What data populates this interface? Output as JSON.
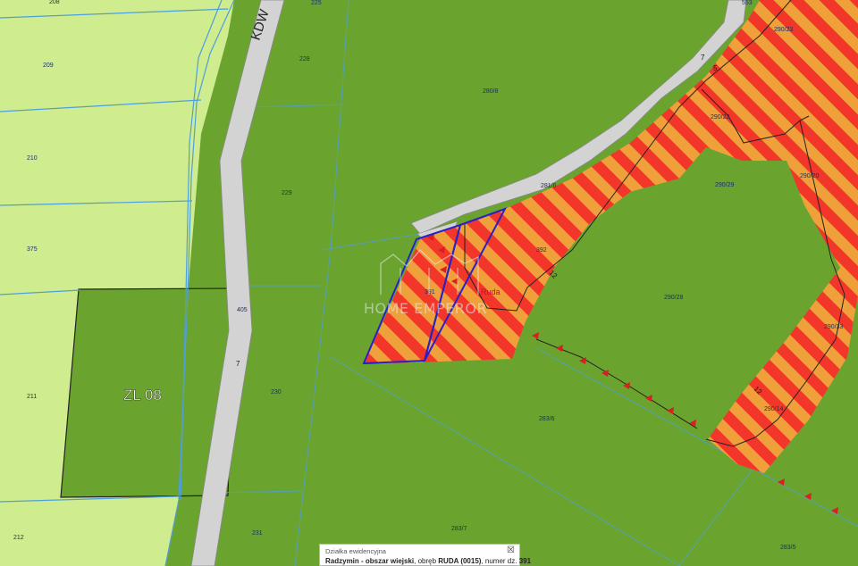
{
  "road_label": "KDW",
  "zone_label": "ZL 08",
  "place_label": "Ruda",
  "watermark": "HOME EMPEROR",
  "colors": {
    "forest": "#6aa42e",
    "agri_light": "#cfec8e",
    "road": "#d3d3d3",
    "hatch_red": "#f2372a",
    "hatch_orange": "#f0a03a",
    "parcel_line": "#4f9fd8",
    "selection": "#2a20c8"
  },
  "parcels": {
    "p208": "208",
    "p209": "209",
    "p210": "210",
    "p375": "375",
    "p211": "211",
    "p212": "212",
    "p228": "228",
    "p229": "229",
    "p230": "230",
    "p231": "231",
    "p405": "405",
    "p280_8": "280/8",
    "p281_6": "281/6",
    "p391": "391",
    "p392": "392",
    "p283_6": "283/6",
    "p283_7": "283/7",
    "p283_5": "283/5",
    "p290_29": "290/29",
    "p290_28": "290/28",
    "p290_20": "290/20",
    "p290_23": "290/23",
    "p290_22": "290/22",
    "p290_33": "290/33",
    "p290_14": "290/14",
    "p225": "225",
    "p553": "553"
  },
  "dims": {
    "d1": "12",
    "d2": "12",
    "d3": "7",
    "d4": "5",
    "d5": "7"
  },
  "popup": {
    "title": "Działka ewidencyjna",
    "close": "☒",
    "line_bold": "Radzymin - obszar wiejski",
    "line_mid": ", obręb ",
    "precinct": "RUDA (0015)",
    "line_num": ", numer dz.",
    "parcel_no": "391"
  }
}
